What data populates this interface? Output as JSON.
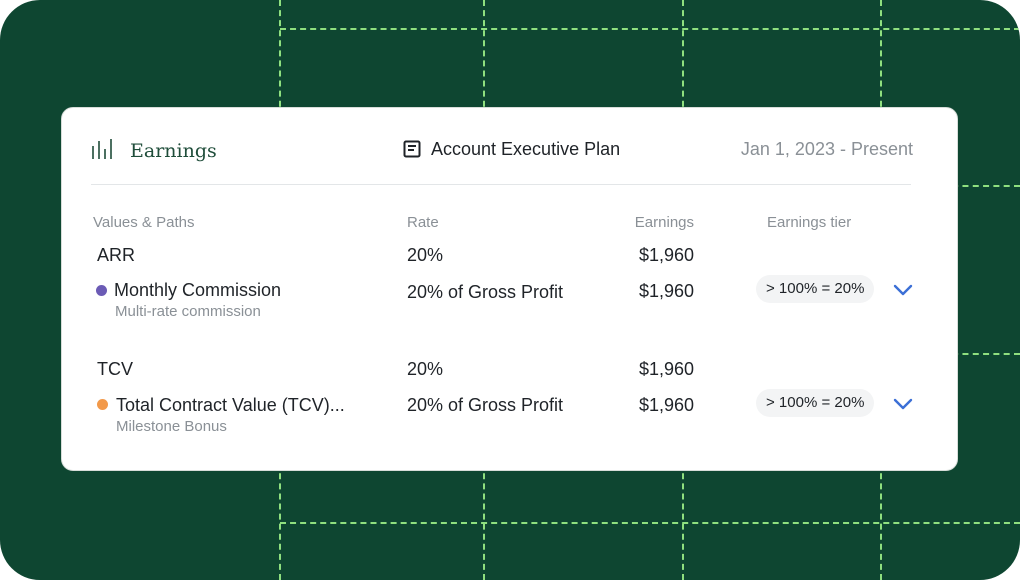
{
  "header": {
    "logo_label": "Earnings",
    "plan_label": "Account Executive Plan",
    "date_range": "Jan 1, 2023 - Present"
  },
  "columns": {
    "values_paths": "Values & Paths",
    "rate": "Rate",
    "earnings": "Earnings",
    "tier": "Earnings tier"
  },
  "groups": [
    {
      "name": "ARR",
      "rate": "20%",
      "earnings": "$1,960",
      "item": {
        "dot_color": "#6b5bb5",
        "label": "Monthly Commission",
        "sublabel": "Multi-rate commission",
        "rate": "20%  of Gross Profit",
        "earnings": "$1,960",
        "tier": "> 100% = 20%"
      }
    },
    {
      "name": "TCV",
      "rate": "20%",
      "earnings": "$1,960",
      "item": {
        "dot_color": "#f2994a",
        "label": "Total Contract Value (TCV)...",
        "sublabel": "Milestone Bonus",
        "rate": "20%  of Gross Profit",
        "earnings": "$1,960",
        "tier": "> 100% = 20%"
      }
    }
  ],
  "colors": {
    "background": "#0e4631",
    "grid_lines": "#8fe07f",
    "accent_chevron": "#3b6fd6"
  },
  "icons": {
    "logo": "bars-icon",
    "plan": "document-icon",
    "expand": "chevron-down-icon"
  }
}
